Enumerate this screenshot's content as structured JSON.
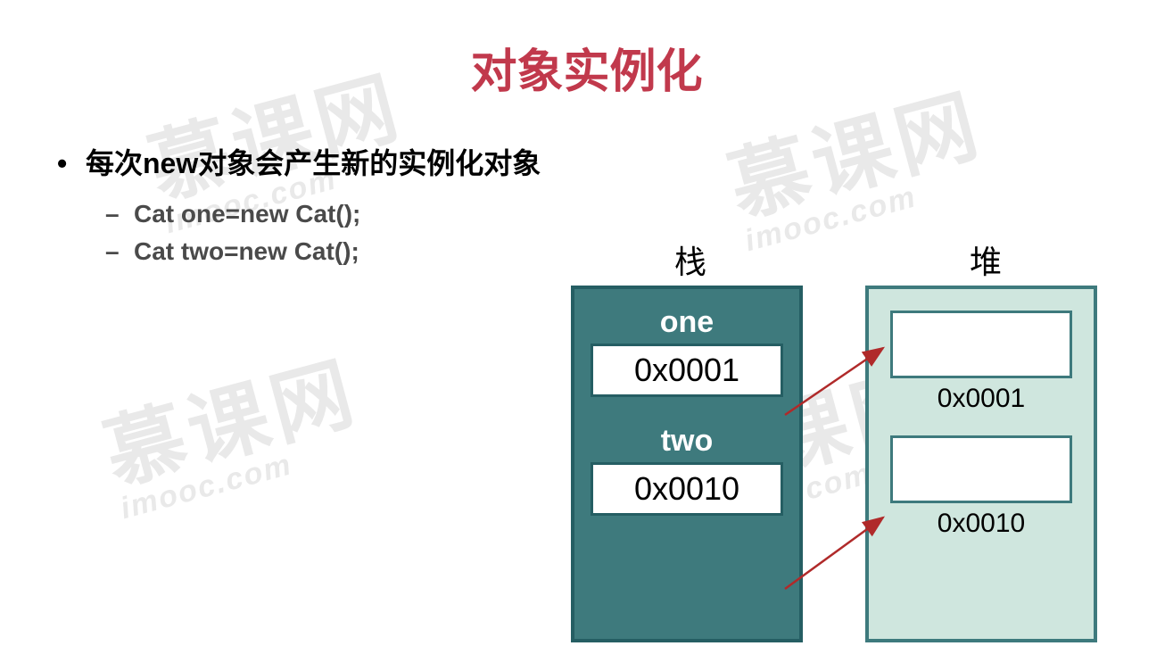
{
  "title": "对象实例化",
  "bullets": {
    "main": "每次new对象会产生新的实例化对象",
    "code1": "Cat one=new Cat();",
    "code2": "Cat two=new Cat();"
  },
  "diagram": {
    "stack_label": "栈",
    "heap_label": "堆",
    "var1_name": "one",
    "var1_addr": "0x0001",
    "var2_name": "two",
    "var2_addr": "0x0010",
    "heap_addr1": "0x0001",
    "heap_addr2": "0x0010"
  },
  "watermark": {
    "text_top": "慕课网",
    "text_bottom": "imooc.com"
  }
}
